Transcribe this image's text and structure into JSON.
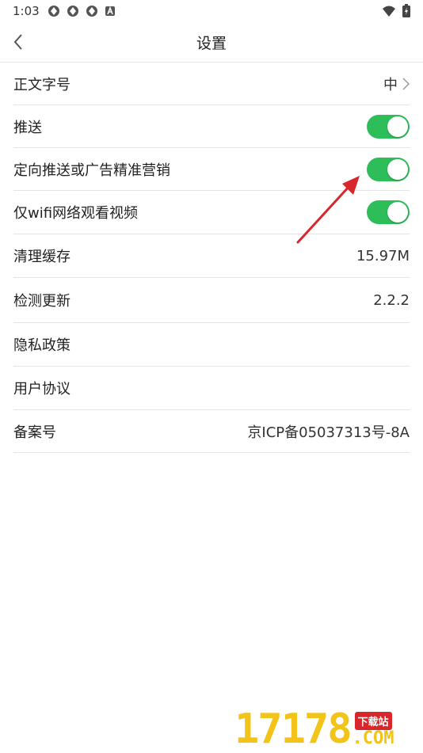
{
  "status_bar": {
    "time": "1:03",
    "notif_icons": [
      "app-notification-icon",
      "app-notification-icon",
      "app-notification-icon",
      "a-badge-icon"
    ],
    "right_icons": [
      "wifi-icon",
      "battery-icon"
    ]
  },
  "header": {
    "title": "设置"
  },
  "settings": {
    "font_size": {
      "label": "正文字号",
      "value": "中"
    },
    "push": {
      "label": "推送",
      "enabled": true
    },
    "targeted_push": {
      "label": "定向推送或广告精准营销",
      "enabled": true
    },
    "wifi_only": {
      "label": "仅wifi网络观看视频",
      "enabled": true
    },
    "clear_cache": {
      "label": "清理缓存",
      "value": "15.97M"
    },
    "check_update": {
      "label": "检测更新",
      "value": "2.2.2"
    },
    "privacy": {
      "label": "隐私政策"
    },
    "agreement": {
      "label": "用户协议"
    },
    "icp": {
      "label": "备案号",
      "value": "京ICP备05037313号-8A"
    }
  },
  "watermark": {
    "digits": "17178",
    "badge": "下载站",
    "com": ".COM"
  },
  "colors": {
    "toggle_on": "#2dbe5a",
    "annotation_arrow": "#d8262a",
    "watermark_yellow": "#f2c318"
  }
}
